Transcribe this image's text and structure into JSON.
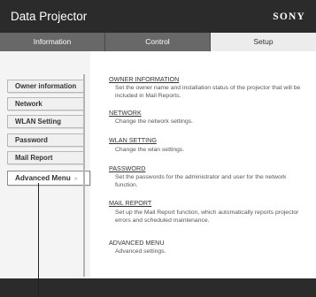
{
  "header": {
    "title": "Data Projector",
    "brand": "SONY"
  },
  "tabs": [
    "Information",
    "Control",
    "Setup"
  ],
  "sidebar": {
    "items": [
      "Owner information",
      "Network",
      "WLAN Setting",
      "Password",
      "Mail Report"
    ],
    "advanced": "Advanced Menu",
    "advanced_chevron": "»"
  },
  "sections": [
    {
      "title": "OWNER INFORMATION",
      "desc": "Set the owner name and installation status of the projector that will be included in Mail Reports."
    },
    {
      "title": "NETWORK",
      "desc": "Change the network settings."
    },
    {
      "title": "WLAN SETTING",
      "desc": "Change the wlan settings."
    },
    {
      "title": "PASSWORD",
      "desc": "Set the passwords for the administrator and user for the network function."
    },
    {
      "title": "MAIL REPORT",
      "desc": "Set up the Mail Report function, which automatically reports projector errors and scheduled maintenance."
    },
    {
      "title": "ADVANCED MENU",
      "desc": "Advanced settings."
    }
  ]
}
